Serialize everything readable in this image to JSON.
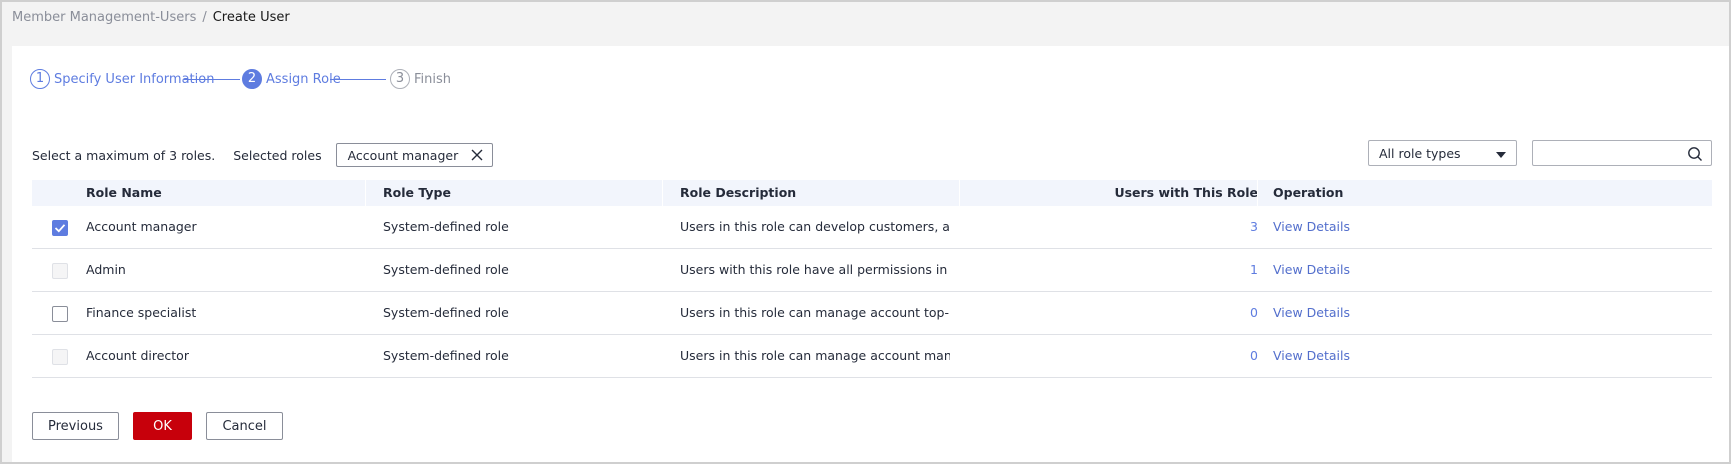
{
  "breadcrumb": {
    "parent": "Member Management-Users",
    "separator": "/",
    "current": "Create User"
  },
  "steps": [
    {
      "number": "1",
      "label": "Specify User Information",
      "state": "completed"
    },
    {
      "number": "2",
      "label": "Assign Role",
      "state": "active"
    },
    {
      "number": "3",
      "label": "Finish",
      "state": "pending"
    }
  ],
  "selection": {
    "max_text": "Select a maximum of 3  roles.",
    "selected_label": "Selected roles",
    "selected_tags": [
      "Account manager"
    ]
  },
  "filter": {
    "role_type_selected": "All role types",
    "search_placeholder": ""
  },
  "table": {
    "columns": [
      "Role Name",
      "Role Type",
      "Role Description",
      "Users with This Role",
      "Operation"
    ],
    "rows": [
      {
        "checked": true,
        "disabled": false,
        "name": "Account manager",
        "type": "System-defined role",
        "description": "Users in this role can develop customers, and view an...",
        "users": "3",
        "operation": "View Details"
      },
      {
        "checked": false,
        "disabled": true,
        "name": "Admin",
        "type": "System-defined role",
        "description": "Users with this role have all permissions in the Partner...",
        "users": "1",
        "operation": "View Details"
      },
      {
        "checked": false,
        "disabled": false,
        "name": "Finance specialist",
        "type": "System-defined role",
        "description": "Users in this role can manage account top-up and wit...",
        "users": "0",
        "operation": "View Details"
      },
      {
        "checked": false,
        "disabled": true,
        "name": "Account director",
        "type": "System-defined role",
        "description": "Users in this role can manage account managers, and ...",
        "users": "0",
        "operation": "View Details"
      }
    ]
  },
  "footer": {
    "previous_label": "Previous",
    "ok_label": "OK",
    "cancel_label": "Cancel"
  },
  "colors": {
    "accent": "#5e7ce0",
    "primary_button": "#c7000b",
    "header_bg": "#f2f5fc"
  }
}
